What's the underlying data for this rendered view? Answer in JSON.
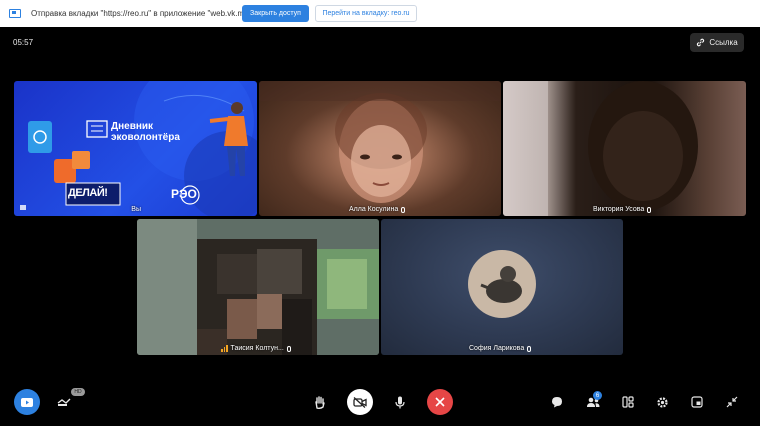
{
  "share_bar": {
    "message": "Отправка вкладки \"https://reo.ru\" в приложение \"web.vk.me\"",
    "close_access_label": "Закрыть доступ",
    "go_to_tab_label": "Перейти на вкладку: reo.ru"
  },
  "call": {
    "elapsed_time": "05:57",
    "link_label": "Ссылка"
  },
  "participants": [
    {
      "name": "Вы",
      "shared_content": {
        "title": "Дневник эковолонтёра",
        "brand_left": "ДЕЛАЙ!",
        "brand_right": "РЭО"
      }
    },
    {
      "name": "Алла Косулина"
    },
    {
      "name": "Виктория Усова"
    },
    {
      "name": "Таисия Колтун..."
    },
    {
      "name": "София Ларикова"
    }
  ],
  "toolbar": {
    "participants_badge": "6",
    "hd_badge": "HD"
  },
  "colors": {
    "accent": "#2d81e0",
    "end_call": "#e64646"
  }
}
